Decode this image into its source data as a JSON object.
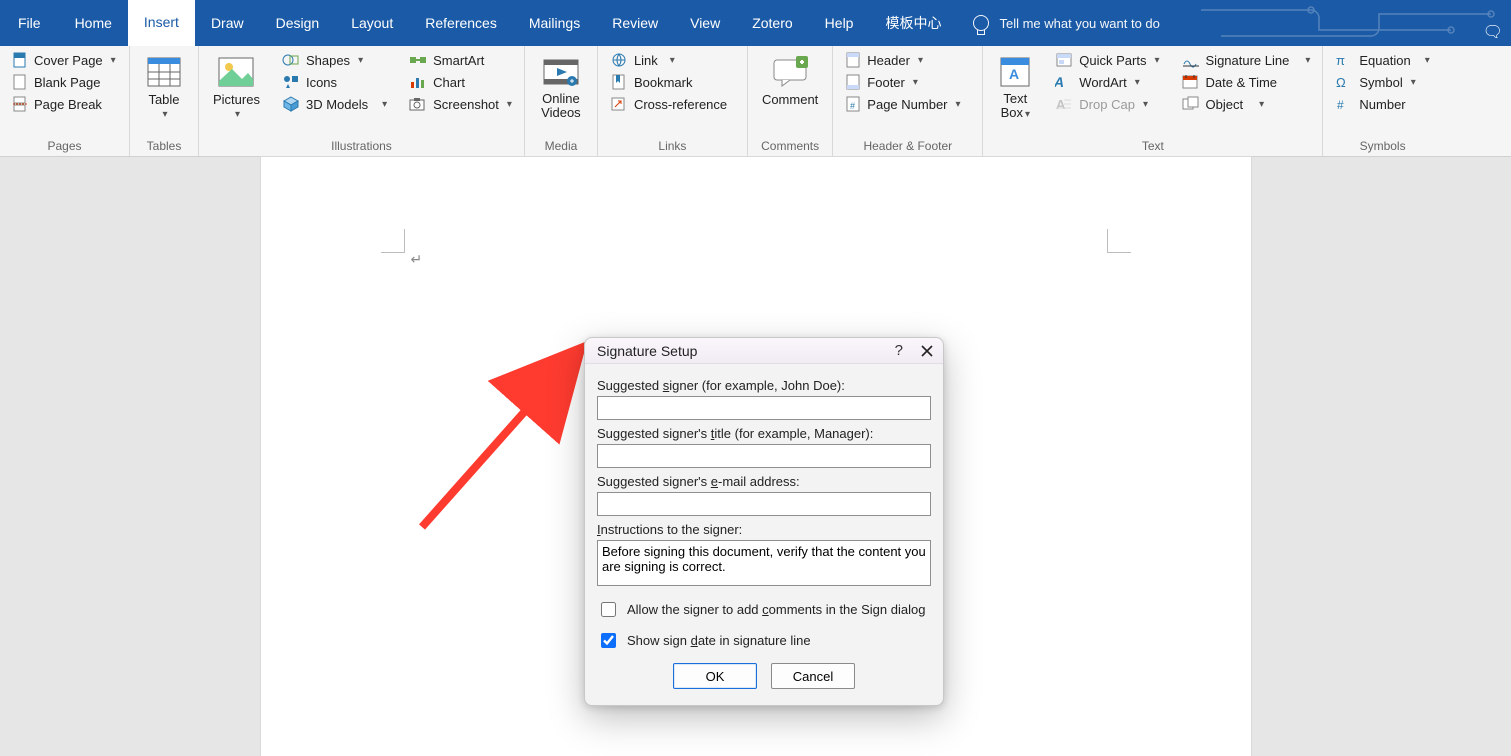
{
  "tabs": {
    "file": "File",
    "home": "Home",
    "insert": "Insert",
    "draw": "Draw",
    "design": "Design",
    "layout": "Layout",
    "references": "References",
    "mailings": "Mailings",
    "review": "Review",
    "view": "View",
    "zotero": "Zotero",
    "help": "Help",
    "templates": "模板中心",
    "tell_me": "Tell me what you want to do"
  },
  "ribbon": {
    "pages": {
      "label": "Pages",
      "cover_page": "Cover Page",
      "blank_page": "Blank Page",
      "page_break": "Page Break"
    },
    "tables": {
      "label": "Tables",
      "table": "Table"
    },
    "illustrations": {
      "label": "Illustrations",
      "pictures": "Pictures",
      "shapes": "Shapes",
      "icons": "Icons",
      "models3d": "3D Models",
      "smartart": "SmartArt",
      "chart": "Chart",
      "screenshot": "Screenshot"
    },
    "media": {
      "label": "Media",
      "online_videos": "Online Videos"
    },
    "links": {
      "label": "Links",
      "link": "Link",
      "bookmark": "Bookmark",
      "cross_reference": "Cross-reference"
    },
    "comments": {
      "label": "Comments",
      "comment": "Comment"
    },
    "header_footer": {
      "label": "Header & Footer",
      "header": "Header",
      "footer": "Footer",
      "page_number": "Page Number"
    },
    "text": {
      "label": "Text",
      "text_box": "Text Box",
      "quick_parts": "Quick Parts",
      "wordart": "WordArt",
      "drop_cap": "Drop Cap",
      "signature_line": "Signature Line",
      "date_time": "Date & Time",
      "object": "Object"
    },
    "symbols": {
      "label": "Symbols",
      "equation": "Equation",
      "symbol": "Symbol",
      "number": "Number"
    }
  },
  "dialog": {
    "title": "Signature Setup",
    "help": "?",
    "labels": {
      "signer_pre": "Suggested ",
      "signer_u": "s",
      "signer_post": "igner (for example, John Doe):",
      "title_pre": "Suggested signer's ",
      "title_u": "t",
      "title_post": "itle (for example, Manager):",
      "email_pre": "Suggested signer's ",
      "email_u": "e",
      "email_post": "-mail address:",
      "instructions_pre": "",
      "instructions_u": "I",
      "instructions_post": "nstructions to the signer:"
    },
    "values": {
      "signer": "",
      "title": "",
      "email": "",
      "instructions": "Before signing this document, verify that the content you are signing is correct."
    },
    "checkboxes": {
      "allow_comments_pre": "Allow the signer to add ",
      "allow_comments_u": "c",
      "allow_comments_post": "omments in the Sign dialog",
      "allow_comments_checked": false,
      "show_date_pre": "Show sign ",
      "show_date_u": "d",
      "show_date_post": "ate in signature line",
      "show_date_checked": true
    },
    "buttons": {
      "ok": "OK",
      "cancel": "Cancel"
    }
  }
}
